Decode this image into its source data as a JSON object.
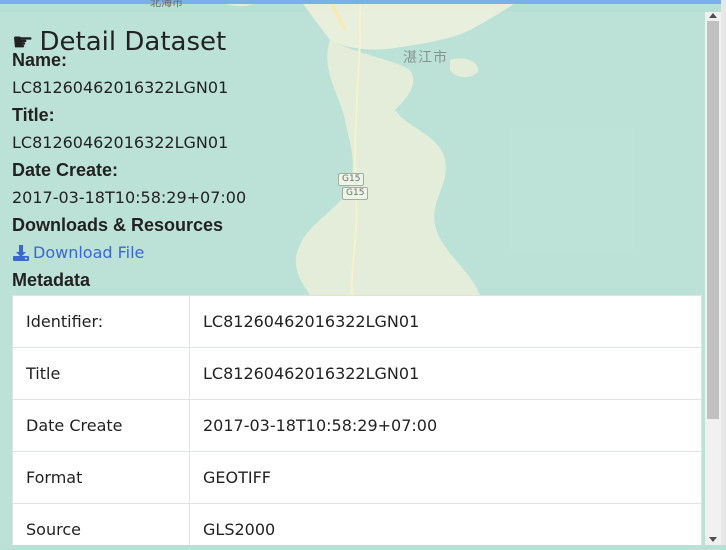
{
  "map": {
    "city_label": "湛江市",
    "top_label": "北海市",
    "shields": [
      "G15",
      "G15"
    ]
  },
  "panel": {
    "title": "Detail Dataset",
    "name_label": "Name:",
    "name_value": "LC81260462016322LGN01",
    "title_label": "Title:",
    "title_value": "LC81260462016322LGN01",
    "date_label": "Date Create:",
    "date_value": "2017-03-18T10:58:29+07:00",
    "downloads_label": "Downloads & Resources",
    "download_link": "Download File",
    "metadata_label": "Metadata"
  },
  "metadata": {
    "rows": [
      {
        "key": "Identifier:",
        "value": "LC81260462016322LGN01"
      },
      {
        "key": "Title",
        "value": "LC81260462016322LGN01"
      },
      {
        "key": "Date Create",
        "value": "2017-03-18T10:58:29+07:00"
      },
      {
        "key": "Format",
        "value": "GEOTIFF"
      },
      {
        "key": "Source",
        "value": "GLS2000"
      }
    ]
  }
}
